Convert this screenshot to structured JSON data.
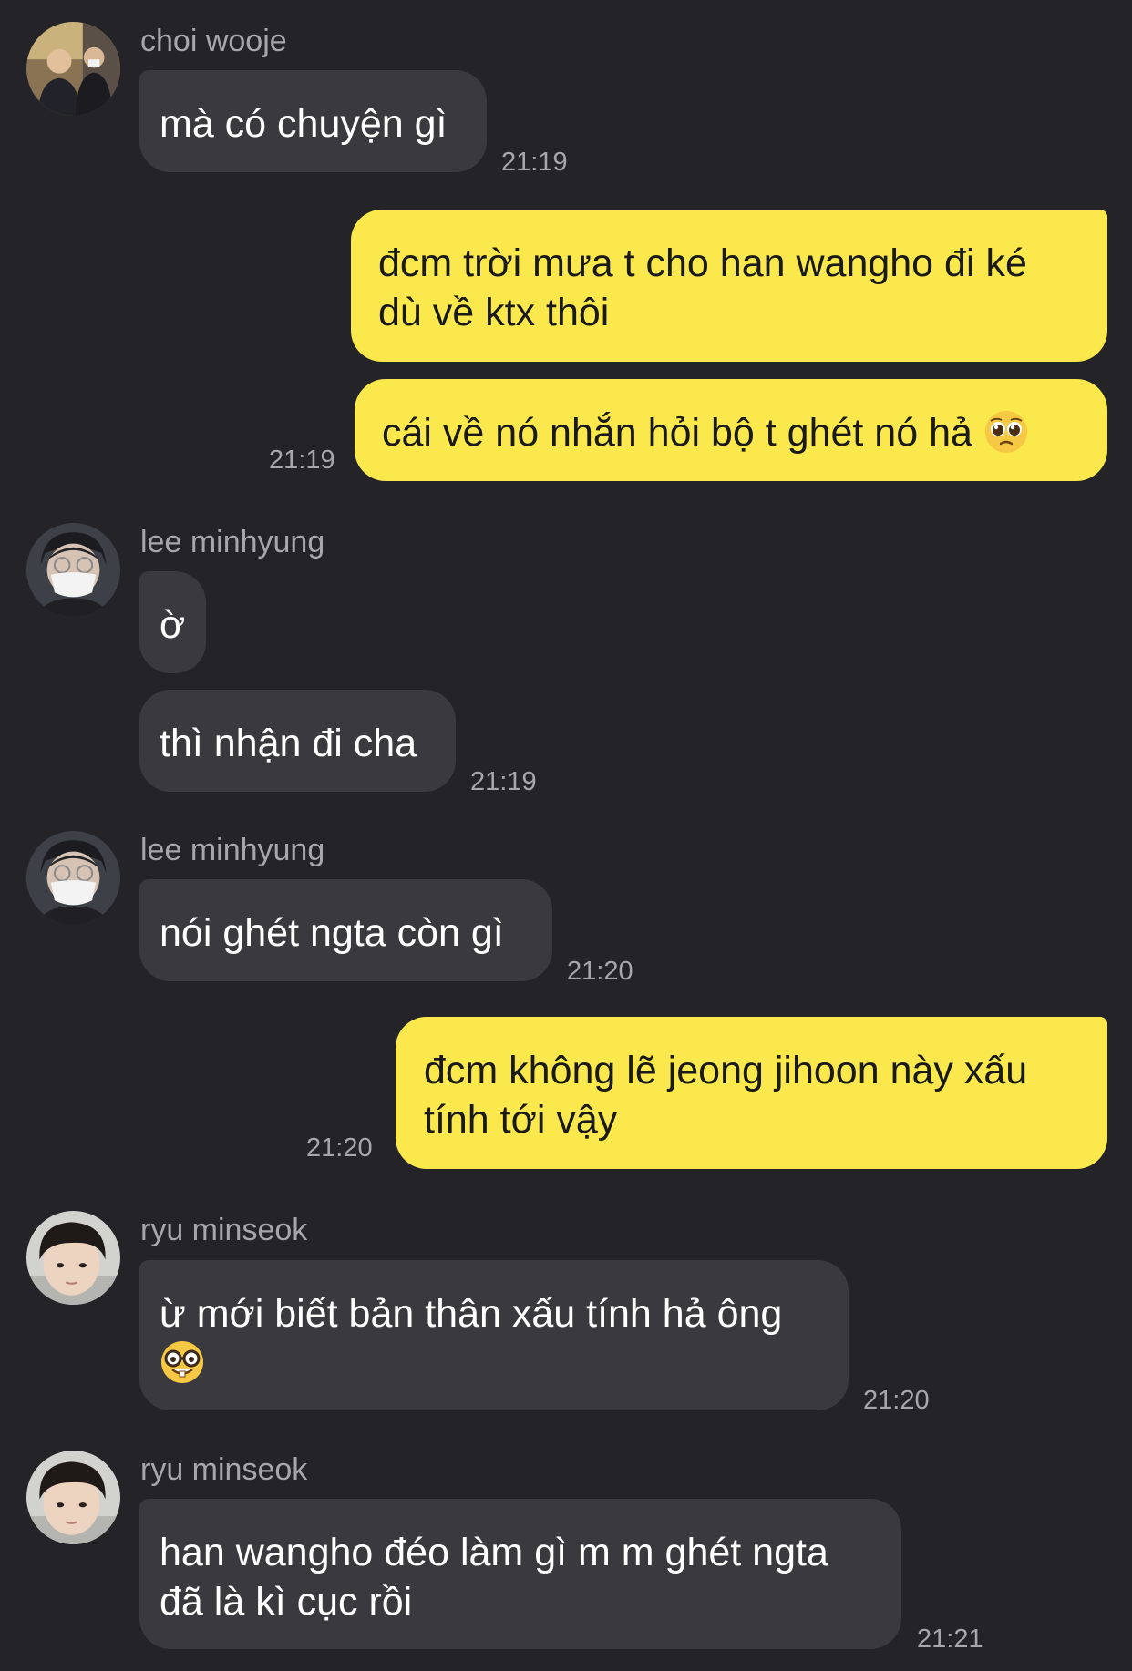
{
  "messages": [
    {
      "sender": "choi wooje",
      "lines": [
        "mà có chuyện gì"
      ],
      "time": "21:19"
    },
    {
      "lines": [
        "đcm trời mưa t cho han wangho đi ké",
        "dù về ktx thôi"
      ]
    },
    {
      "text": "cái về nó nhắn hỏi bộ t ghét nó hả",
      "emoji": "pleading-face-emoji",
      "time": "21:19"
    },
    {
      "sender": "lee minhyung",
      "lines": [
        "ờ"
      ]
    },
    {
      "lines": [
        "thì nhận đi cha"
      ],
      "time": "21:19"
    },
    {
      "sender": "lee minhyung",
      "lines": [
        "nói ghét ngta còn gì"
      ],
      "time": "21:20"
    },
    {
      "lines": [
        "đcm không lẽ jeong jihoon này xấu",
        "tính tới vậy"
      ],
      "time": "21:20"
    },
    {
      "sender": "ryu minseok",
      "lines": [
        "ừ mới biết bản thân xấu tính hả ông"
      ],
      "emoji": "nerd-face-emoji",
      "time": "21:20"
    },
    {
      "sender": "ryu minseok",
      "lines": [
        "han wangho đéo làm gì m m ghét ngta",
        "đã là kì cục rồi"
      ],
      "time": "21:21"
    }
  ],
  "colors": {
    "background": "#242428",
    "incoming_bubble": "#3a3a3e",
    "outgoing_bubble": "#fae84c",
    "meta_text": "#a6a6ab"
  }
}
